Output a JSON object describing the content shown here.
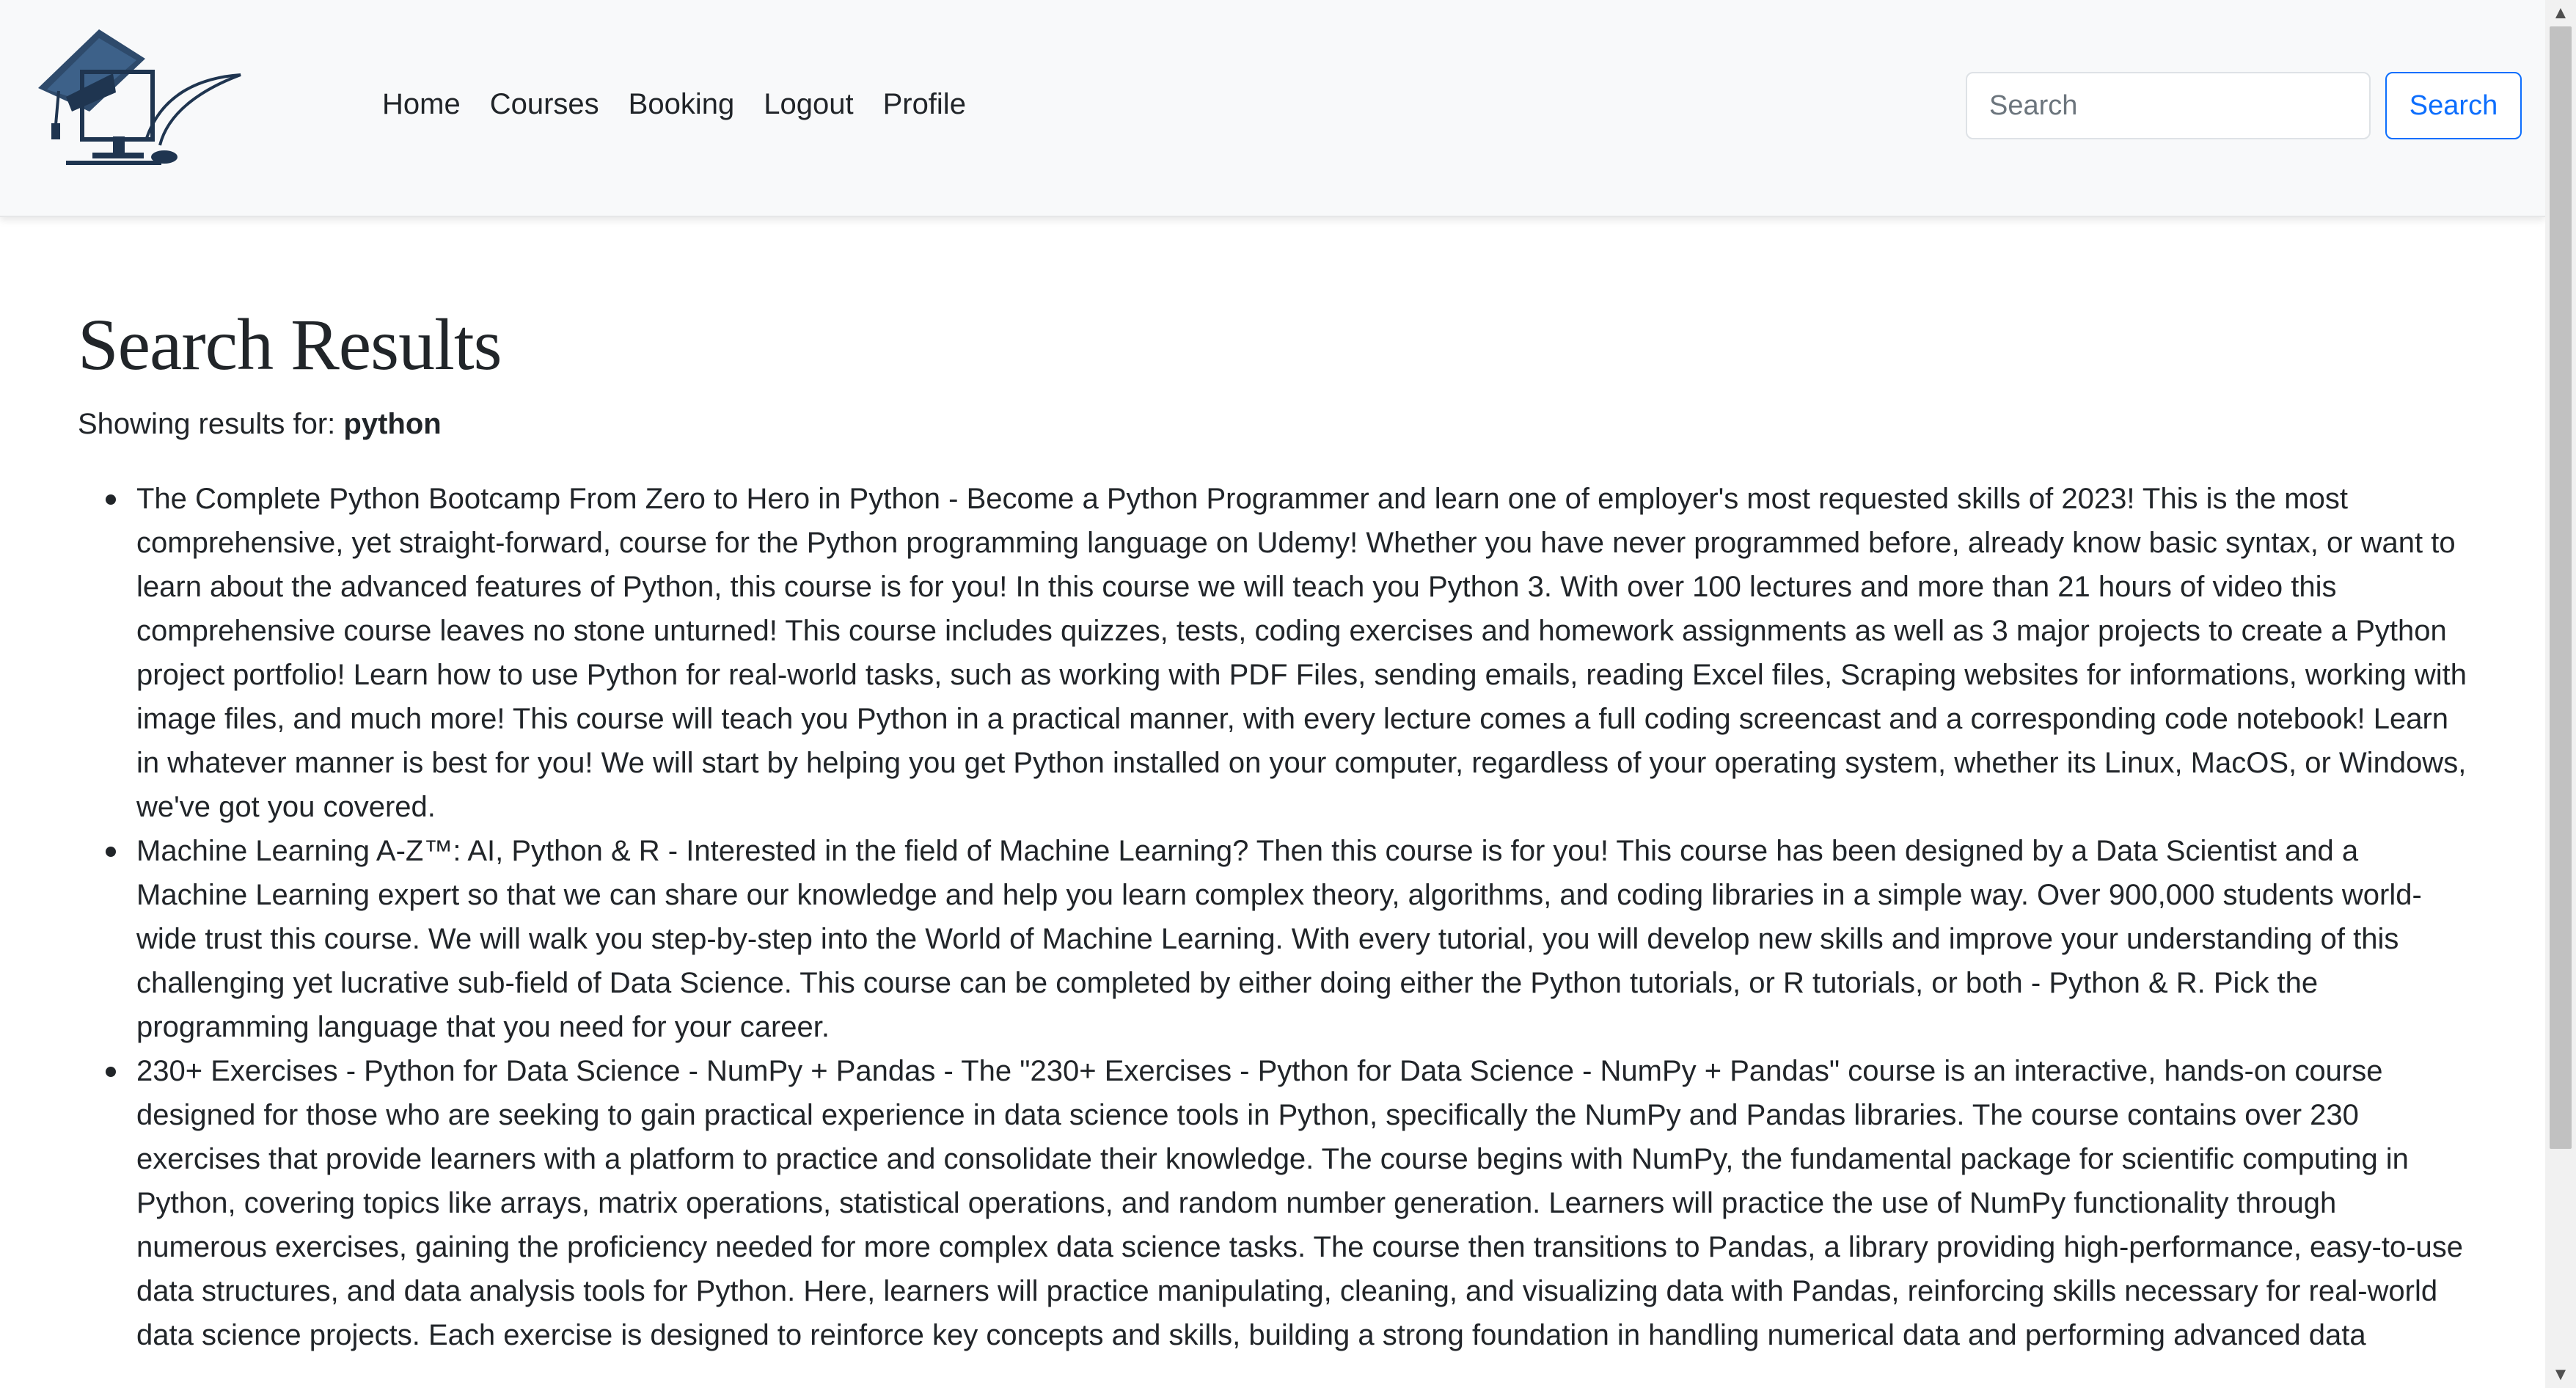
{
  "navbar": {
    "logo_icon": "graduation-cap-computer-logo",
    "links": [
      "Home",
      "Courses",
      "Booking",
      "Logout",
      "Profile"
    ],
    "search_placeholder": "Search",
    "search_button": "Search"
  },
  "main": {
    "title": "Search Results",
    "results_for_label": "Showing results for:",
    "query": "python",
    "results": [
      "The Complete Python Bootcamp From Zero to Hero in Python - Become a Python Programmer and learn one of employer's most requested skills of 2023! This is the most comprehensive, yet straight-forward, course for the Python programming language on Udemy! Whether you have never programmed before, already know basic syntax, or want to learn about the advanced features of Python, this course is for you! In this course we will teach you Python 3. With over 100 lectures and more than 21 hours of video this comprehensive course leaves no stone unturned! This course includes quizzes, tests, coding exercises and homework assignments as well as 3 major projects to create a Python project portfolio! Learn how to use Python for real-world tasks, such as working with PDF Files, sending emails, reading Excel files, Scraping websites for informations, working with image files, and much more! This course will teach you Python in a practical manner, with every lecture comes a full coding screencast and a corresponding code notebook! Learn in whatever manner is best for you! We will start by helping you get Python installed on your computer, regardless of your operating system, whether its Linux, MacOS, or Windows, we've got you covered.",
      "Machine Learning A-Z™: AI, Python & R - Interested in the field of Machine Learning? Then this course is for you! This course has been designed by a Data Scientist and a Machine Learning expert so that we can share our knowledge and help you learn complex theory, algorithms, and coding libraries in a simple way. Over 900,000 students world-wide trust this course. We will walk you step-by-step into the World of Machine Learning. With every tutorial, you will develop new skills and improve your understanding of this challenging yet lucrative sub-field of Data Science. This course can be completed by either doing either the Python tutorials, or R tutorials, or both - Python & R. Pick the programming language that you need for your career.",
      "230+ Exercises - Python for Data Science - NumPy + Pandas - The \"230+ Exercises - Python for Data Science - NumPy + Pandas\" course is an interactive, hands-on course designed for those who are seeking to gain practical experience in data science tools in Python, specifically the NumPy and Pandas libraries. The course contains over 230 exercises that provide learners with a platform to practice and consolidate their knowledge. The course begins with NumPy, the fundamental package for scientific computing in Python, covering topics like arrays, matrix operations, statistical operations, and random number generation. Learners will practice the use of NumPy functionality through numerous exercises, gaining the proficiency needed for more complex data science tasks. The course then transitions to Pandas, a library providing high-performance, easy-to-use data structures, and data analysis tools for Python. Here, learners will practice manipulating, cleaning, and visualizing data with Pandas, reinforcing skills necessary for real-world data science projects. Each exercise is designed to reinforce key concepts and skills, building a strong foundation in handling numerical data and performing advanced data"
    ]
  },
  "scrollbar": {
    "up_icon": "scroll-up-arrow-icon",
    "down_icon": "scroll-down-arrow-icon"
  }
}
